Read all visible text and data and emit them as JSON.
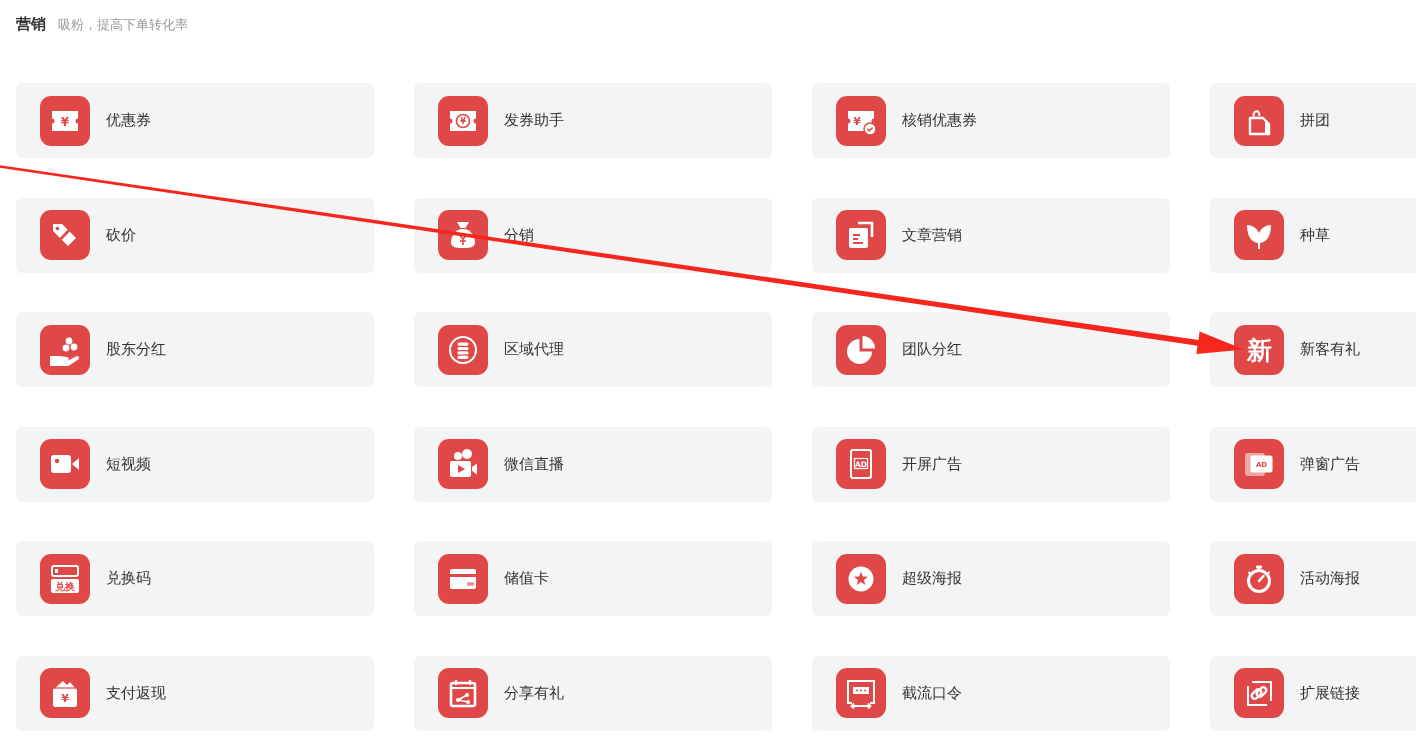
{
  "section": {
    "title": "营销",
    "subtitle": "吸粉，提高下单转化率"
  },
  "tools": [
    {
      "label": "优惠券",
      "icon_text": "¥"
    },
    {
      "label": "发券助手",
      "icon_text": "¥"
    },
    {
      "label": "核销优惠券",
      "icon_text": "¥"
    },
    {
      "label": "拼团"
    },
    {
      "label": "砍价"
    },
    {
      "label": "分销"
    },
    {
      "label": "文章营销"
    },
    {
      "label": "种草"
    },
    {
      "label": "股东分红"
    },
    {
      "label": "区域代理"
    },
    {
      "label": "团队分红"
    },
    {
      "label": "新客有礼",
      "icon_text": "新"
    },
    {
      "label": "短视频"
    },
    {
      "label": "微信直播"
    },
    {
      "label": "开屏广告",
      "icon_text": "AD"
    },
    {
      "label": "弹窗广告",
      "icon_text": "AD"
    },
    {
      "label": "兑换码",
      "icon_text": "兑换"
    },
    {
      "label": "储值卡"
    },
    {
      "label": "超级海报"
    },
    {
      "label": "活动海报"
    },
    {
      "label": "支付返现",
      "icon_text": "¥"
    },
    {
      "label": "分享有礼"
    },
    {
      "label": "截流口令"
    },
    {
      "label": "扩展链接"
    }
  ]
}
